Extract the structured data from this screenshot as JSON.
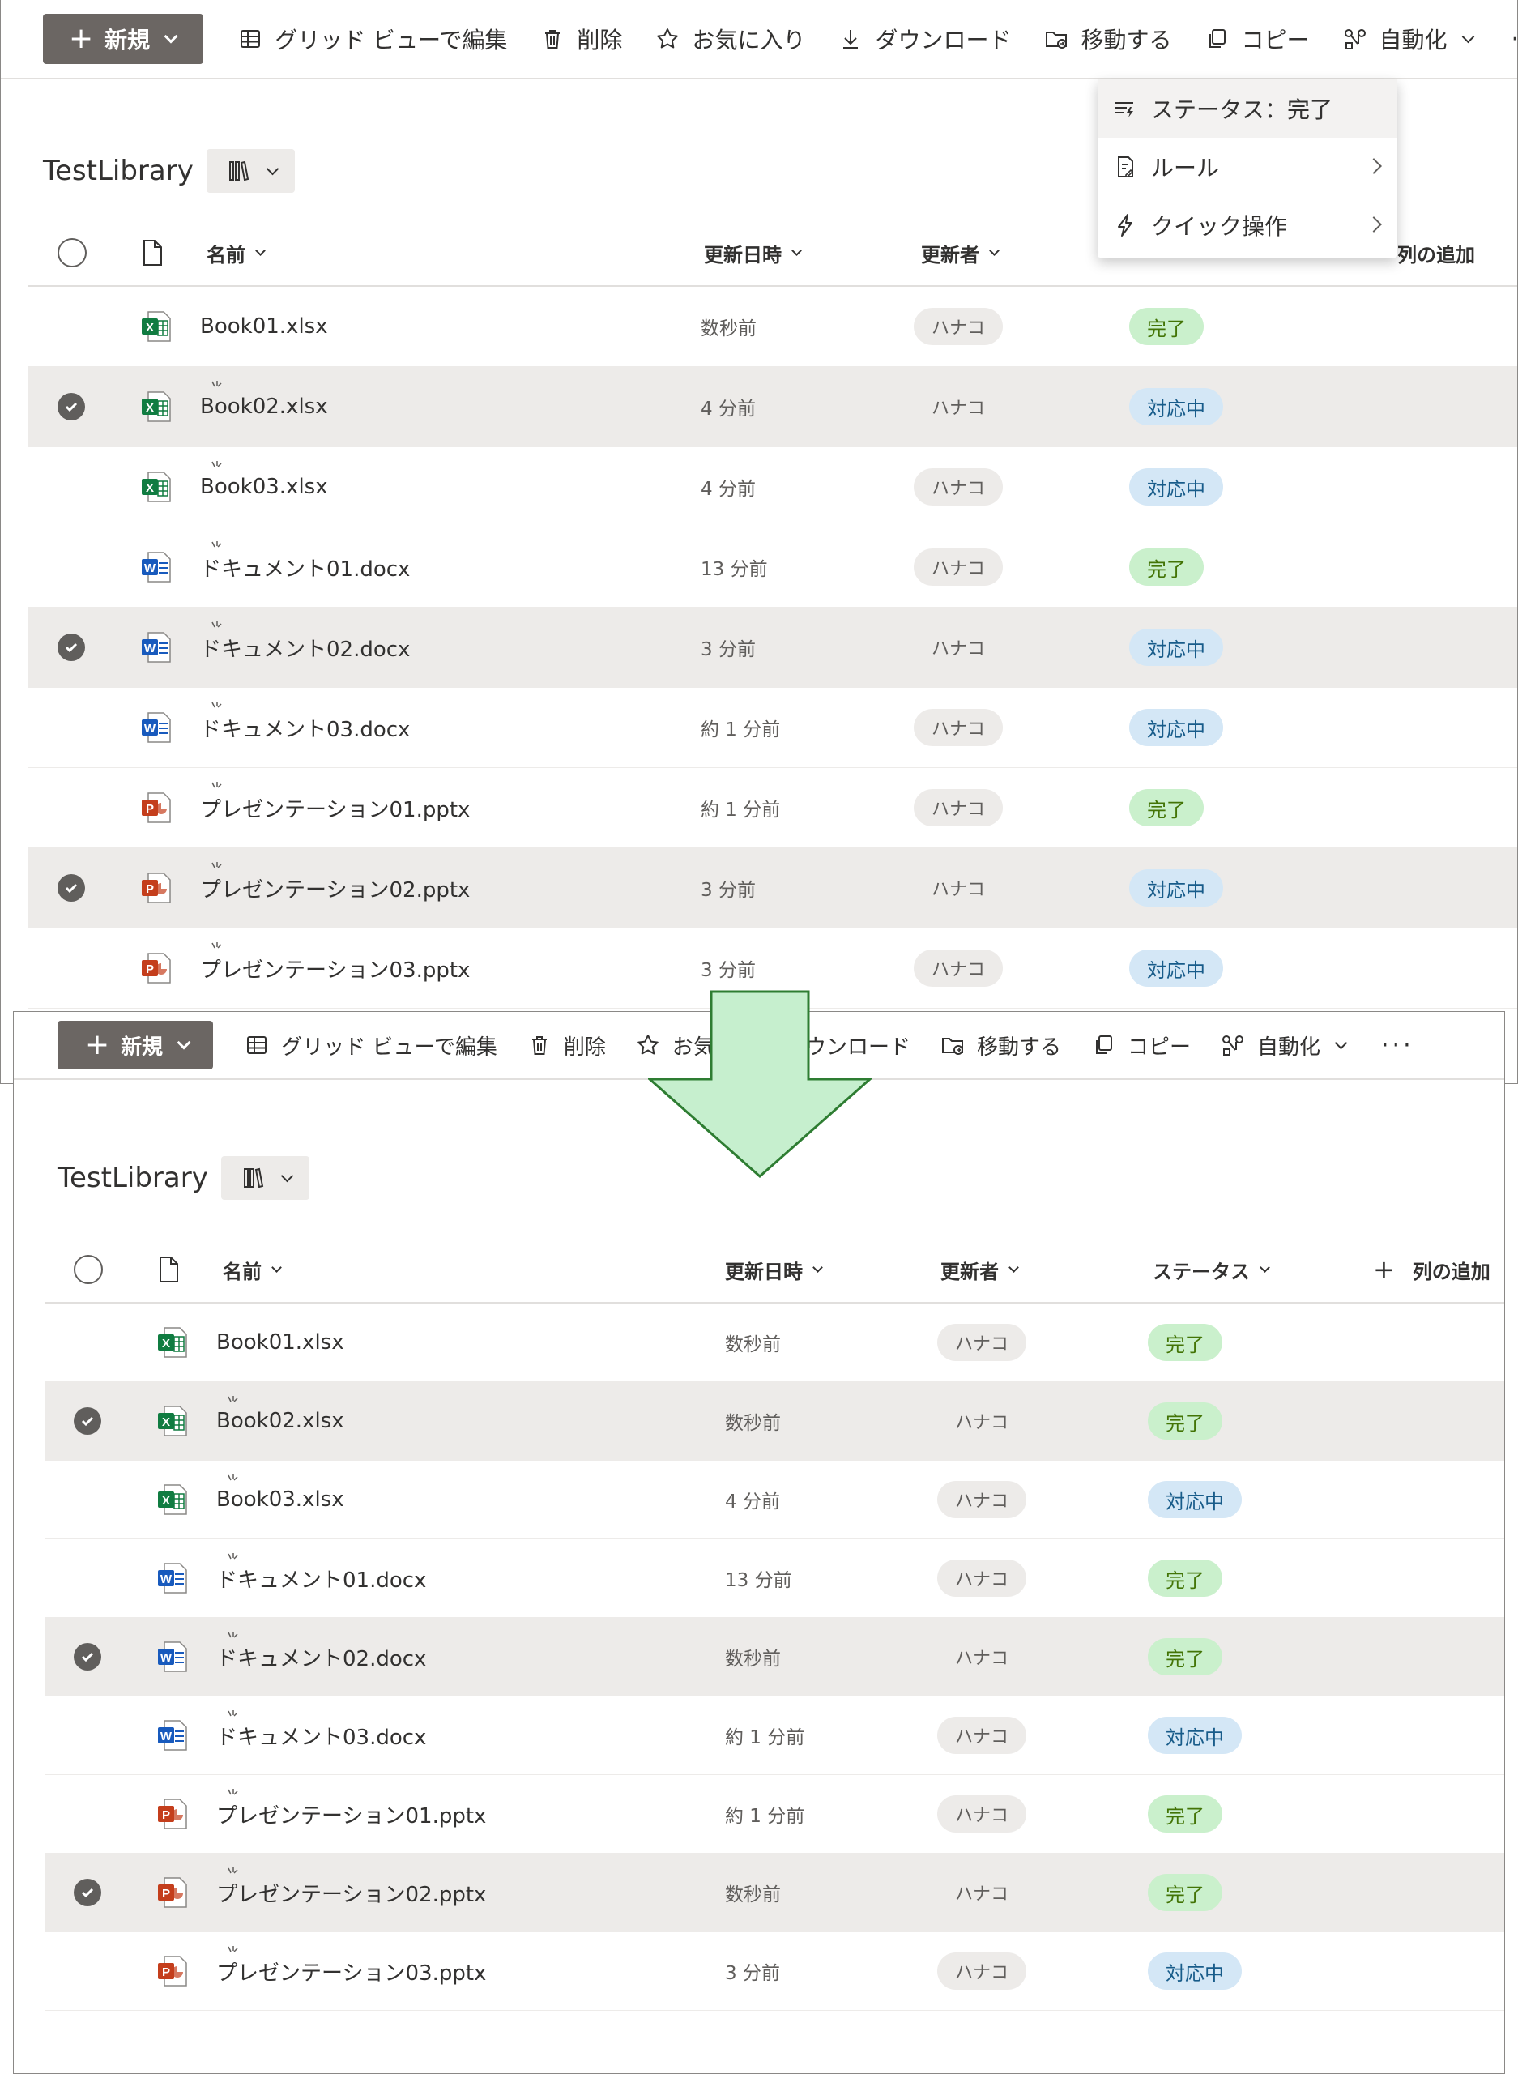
{
  "toolbar": {
    "new_label": "新規",
    "grid_label": "グリッド ビューで編集",
    "delete_label": "削除",
    "favorite_label": "お気に入り",
    "download_label": "ダウンロード",
    "move_label": "移動する",
    "copy_label": "コピー",
    "automate_label": "自動化",
    "more_label": "···"
  },
  "toolbar_after": {
    "favorite_label_visible": "お気"
  },
  "automate_menu": {
    "items": [
      {
        "label": "ステータス：完了"
      },
      {
        "label": "ルール"
      },
      {
        "label": "クイック操作"
      }
    ]
  },
  "library": {
    "title": "TestLibrary",
    "columns": {
      "name": "名前",
      "modified": "更新日時",
      "modified_by": "更新者",
      "status": "ステータス",
      "add_column": "列の追加",
      "add_column_partial": "列の追加"
    }
  },
  "colors": {
    "excel": "#107c41",
    "word": "#185abd",
    "powerpoint": "#c43e1c",
    "done_bg": "#caf0cc",
    "progress_bg": "#d4e7f6",
    "arrow_fill": "#c6efce",
    "arrow_stroke": "#2e7d32"
  },
  "before": {
    "rows": [
      {
        "name": "Book01.xlsx",
        "type": "excel",
        "modified": "数秒前",
        "user": "ハナコ",
        "status": "完了",
        "selected": false,
        "new": false
      },
      {
        "name": "Book02.xlsx",
        "type": "excel",
        "modified": "4 分前",
        "user": "ハナコ",
        "status": "対応中",
        "selected": true,
        "new": true
      },
      {
        "name": "Book03.xlsx",
        "type": "excel",
        "modified": "4 分前",
        "user": "ハナコ",
        "status": "対応中",
        "selected": false,
        "new": true
      },
      {
        "name": "ドキュメント01.docx",
        "type": "word",
        "modified": "13 分前",
        "user": "ハナコ",
        "status": "完了",
        "selected": false,
        "new": true
      },
      {
        "name": "ドキュメント02.docx",
        "type": "word",
        "modified": "3 分前",
        "user": "ハナコ",
        "status": "対応中",
        "selected": true,
        "new": true
      },
      {
        "name": "ドキュメント03.docx",
        "type": "word",
        "modified": "約 1 分前",
        "user": "ハナコ",
        "status": "対応中",
        "selected": false,
        "new": true
      },
      {
        "name": "プレゼンテーション01.pptx",
        "type": "powerpoint",
        "modified": "約 1 分前",
        "user": "ハナコ",
        "status": "完了",
        "selected": false,
        "new": true
      },
      {
        "name": "プレゼンテーション02.pptx",
        "type": "powerpoint",
        "modified": "3 分前",
        "user": "ハナコ",
        "status": "対応中",
        "selected": true,
        "new": true
      },
      {
        "name": "プレゼンテーション03.pptx",
        "type": "powerpoint",
        "modified": "3 分前",
        "user": "ハナコ",
        "status": "対応中",
        "selected": false,
        "new": true
      }
    ]
  },
  "after": {
    "rows": [
      {
        "name": "Book01.xlsx",
        "type": "excel",
        "modified": "数秒前",
        "user": "ハナコ",
        "status": "完了",
        "selected": false,
        "new": false
      },
      {
        "name": "Book02.xlsx",
        "type": "excel",
        "modified": "数秒前",
        "user": "ハナコ",
        "status": "完了",
        "selected": true,
        "new": true
      },
      {
        "name": "Book03.xlsx",
        "type": "excel",
        "modified": "4 分前",
        "user": "ハナコ",
        "status": "対応中",
        "selected": false,
        "new": true
      },
      {
        "name": "ドキュメント01.docx",
        "type": "word",
        "modified": "13 分前",
        "user": "ハナコ",
        "status": "完了",
        "selected": false,
        "new": true
      },
      {
        "name": "ドキュメント02.docx",
        "type": "word",
        "modified": "数秒前",
        "user": "ハナコ",
        "status": "完了",
        "selected": true,
        "new": true
      },
      {
        "name": "ドキュメント03.docx",
        "type": "word",
        "modified": "約 1 分前",
        "user": "ハナコ",
        "status": "対応中",
        "selected": false,
        "new": true
      },
      {
        "name": "プレゼンテーション01.pptx",
        "type": "powerpoint",
        "modified": "約 1 分前",
        "user": "ハナコ",
        "status": "完了",
        "selected": false,
        "new": true
      },
      {
        "name": "プレゼンテーション02.pptx",
        "type": "powerpoint",
        "modified": "数秒前",
        "user": "ハナコ",
        "status": "完了",
        "selected": true,
        "new": true
      },
      {
        "name": "プレゼンテーション03.pptx",
        "type": "powerpoint",
        "modified": "3 分前",
        "user": "ハナコ",
        "status": "対応中",
        "selected": false,
        "new": true
      }
    ]
  }
}
